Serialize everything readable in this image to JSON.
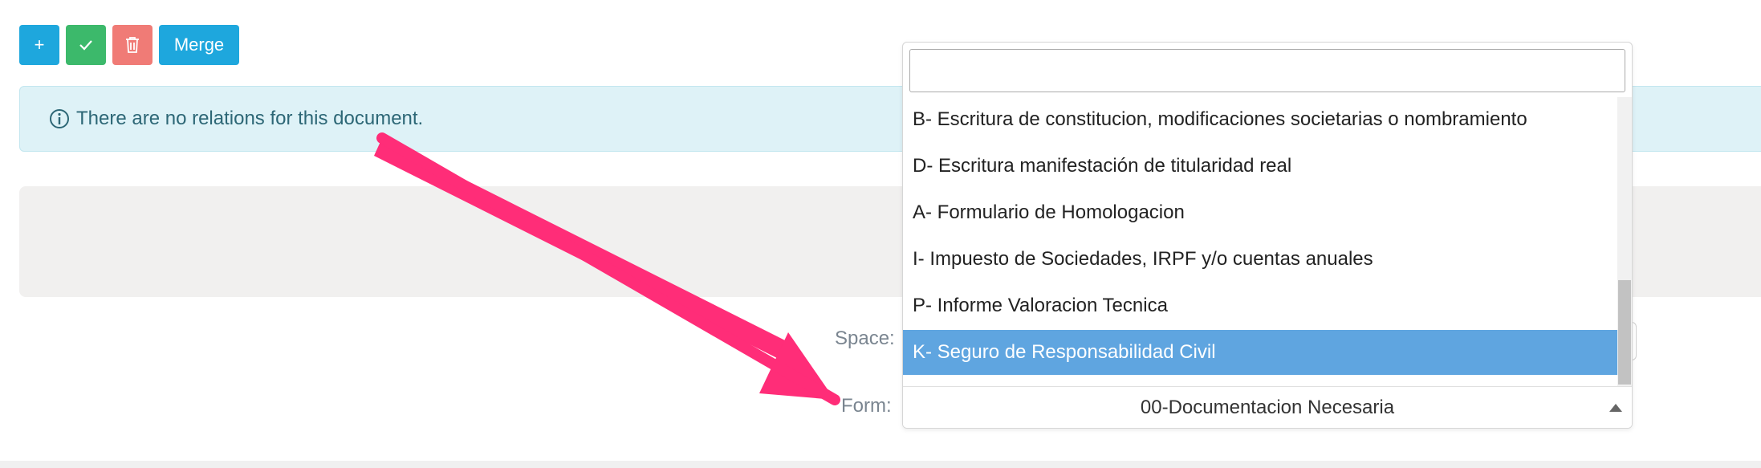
{
  "toolbar": {
    "add_label": "+",
    "merge_label": "Merge",
    "icons": [
      "plus-icon",
      "check-icon",
      "trash-icon"
    ]
  },
  "alert": {
    "message": "There are no relations for this document."
  },
  "fields": {
    "space_label": "Space:",
    "form_label": "Form:"
  },
  "form_select": {
    "selected_value": "00-Documentacion Necesaria",
    "search_value": "",
    "options": [
      "B- Escritura de constitucion, modificaciones societarias o nombramiento",
      "D- Escritura manifestación de titularidad real",
      "A- Formulario de Homologacion",
      "I- Impuesto de Sociedades, IRPF y/o cuentas anuales",
      "P- Informe Valoracion Tecnica",
      "K- Seguro de Responsabilidad Civil"
    ],
    "highlighted_option": "K- Seguro de Responsabilidad Civil"
  },
  "colors": {
    "primary": "#1ea7dd",
    "success": "#3cb96b",
    "danger": "#f07b76",
    "highlight": "#5fa5e0",
    "annotation_arrow": "#ff2d78"
  }
}
